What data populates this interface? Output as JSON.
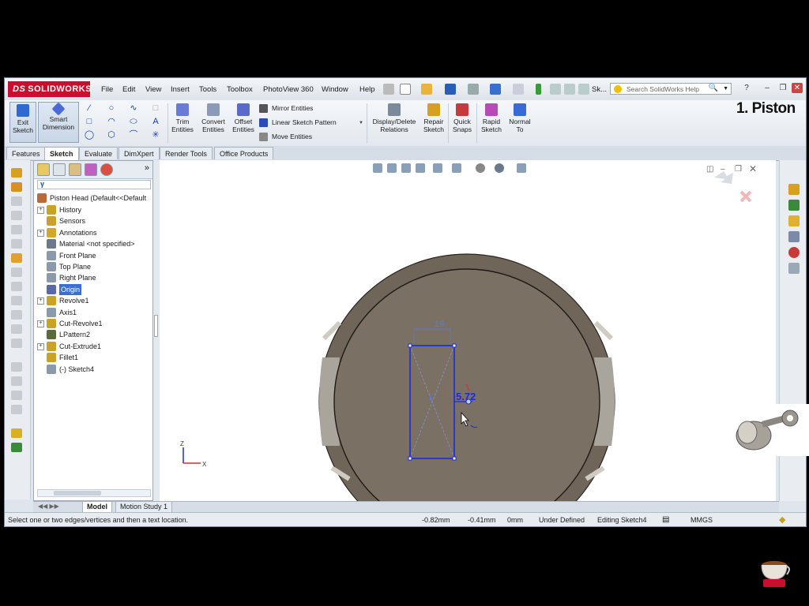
{
  "app": {
    "brand": "SOLIDWORKS",
    "brand_prefix": "DS",
    "menu": [
      "File",
      "Edit",
      "View",
      "Insert",
      "Tools",
      "Toolbox",
      "PhotoView 360",
      "Window",
      "Help"
    ],
    "sketch_short": "Sk...",
    "search_placeholder": "Search SolidWorks Help"
  },
  "overlay_title": "1. Piston",
  "commands": {
    "exit_sketch": "Exit Sketch",
    "smart_dimension": "Smart Dimension",
    "trim_entities": "Trim Entities",
    "convert_entities": "Convert Entities",
    "offset_entities": "Offset Entities",
    "mirror_entities": "Mirror Entities",
    "linear_sketch_pattern": "Linear Sketch Pattern",
    "move_entities": "Move Entities",
    "display_delete_relations": "Display/Delete Relations",
    "repair_sketch": "Repair Sketch",
    "quick_snaps": "Quick Snaps",
    "rapid_sketch": "Rapid Sketch",
    "normal_to": "Normal To"
  },
  "cm_tabs": [
    "Features",
    "Sketch",
    "Evaluate",
    "DimXpert",
    "Render Tools",
    "Office Products"
  ],
  "cm_active_tab": "Sketch",
  "tree": {
    "root": "Piston Head  (Default<<Default",
    "items": [
      {
        "label": "History",
        "expand": true,
        "icon": "history-icon",
        "color": "#c9a227"
      },
      {
        "label": "Sensors",
        "expand": false,
        "icon": "sensors-icon",
        "color": "#c9a227"
      },
      {
        "label": "Annotations",
        "expand": true,
        "icon": "annotations-icon",
        "color": "#d4a82a"
      },
      {
        "label": "Material <not specified>",
        "expand": false,
        "icon": "material-icon",
        "color": "#6a7a8a"
      },
      {
        "label": "Front Plane",
        "expand": false,
        "icon": "plane-icon",
        "color": "#8a9aaa"
      },
      {
        "label": "Top Plane",
        "expand": false,
        "icon": "plane-icon",
        "color": "#8a9aaa"
      },
      {
        "label": "Right Plane",
        "expand": false,
        "icon": "plane-icon",
        "color": "#8a9aaa"
      },
      {
        "label": "Origin",
        "expand": false,
        "icon": "origin-icon",
        "color": "#5a6aa8",
        "selected": true
      },
      {
        "label": "Revolve1",
        "expand": true,
        "icon": "revolve-icon",
        "color": "#c9a227"
      },
      {
        "label": "Axis1",
        "expand": false,
        "icon": "axis-icon",
        "color": "#8a9aaa"
      },
      {
        "label": "Cut-Revolve1",
        "expand": true,
        "icon": "cut-revolve-icon",
        "color": "#c9a227"
      },
      {
        "label": "LPattern2",
        "expand": false,
        "icon": "lpattern-icon",
        "color": "#5a6a3a"
      },
      {
        "label": "Cut-Extrude1",
        "expand": true,
        "icon": "cut-extrude-icon",
        "color": "#c9a227"
      },
      {
        "label": "Fillet1",
        "expand": false,
        "icon": "fillet-icon",
        "color": "#c9a227"
      },
      {
        "label": "(-) Sketch4",
        "expand": false,
        "icon": "sketch-icon",
        "color": "#8a9aaa"
      }
    ]
  },
  "sketch": {
    "dim_width": "19",
    "dim_offset": "5.72"
  },
  "triad": {
    "z": "Z",
    "x": "X"
  },
  "model_tabs": [
    "Model",
    "Motion Study 1"
  ],
  "model_active_tab": "Model",
  "status": {
    "hint": "Select one or two edges/vertices and then a text location.",
    "x": "-0.82mm",
    "y": "-0.41mm",
    "z": "0mm",
    "state": "Under Defined",
    "editing": "Editing Sketch4",
    "units": "MMGS"
  },
  "colors": {
    "accent": "#c8102e",
    "sketch_blue": "#1a2cd8",
    "part_face": "#7d7266",
    "selection": "#3a6fd0"
  }
}
